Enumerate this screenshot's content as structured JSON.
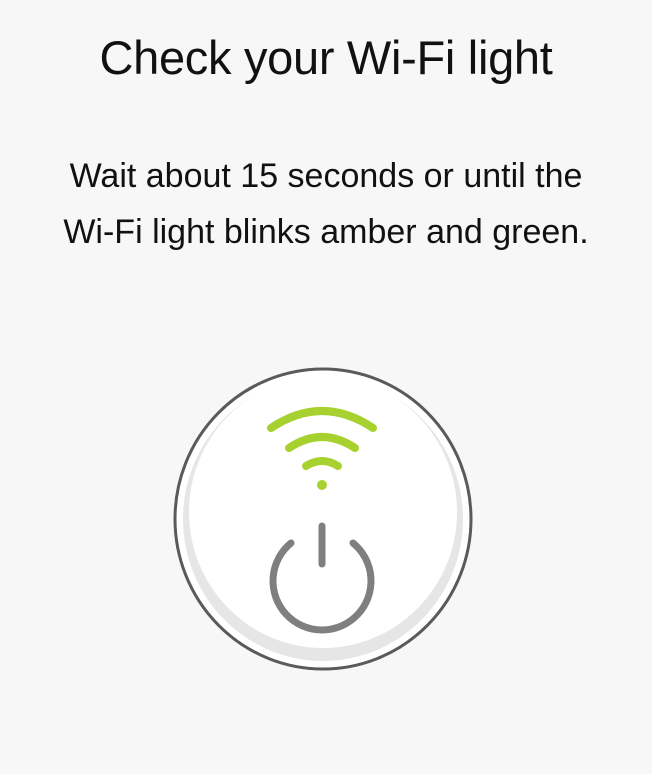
{
  "screen": {
    "title": "Check your Wi-Fi light",
    "instruction_lines": [
      "Wait about 15 seconds or until the",
      "Wi-Fi light blinks amber and green."
    ]
  },
  "device": {
    "wifi_indicator_color": "#a6d12f",
    "power_icon_color": "#7f7f7f",
    "body_color": "#ffffff",
    "ring_color": "#e6e6e6",
    "outline_color": "#5a5a5a",
    "icons": [
      "wifi-icon",
      "power-icon"
    ]
  }
}
